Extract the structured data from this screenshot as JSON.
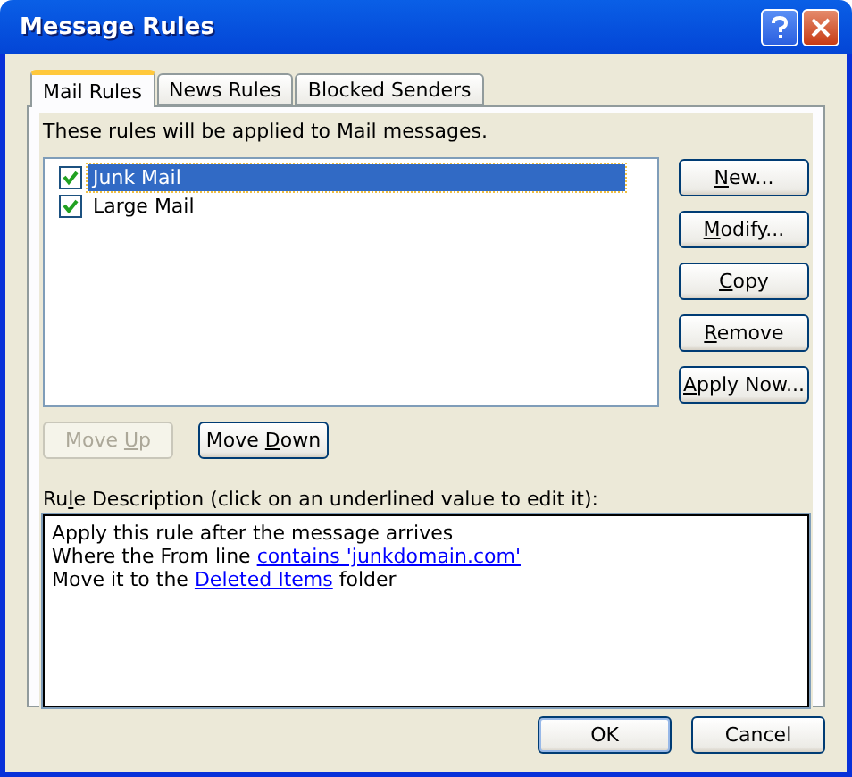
{
  "window": {
    "title": "Message Rules"
  },
  "tabs": [
    {
      "label": "Mail Rules",
      "selected": true
    },
    {
      "label": "News Rules",
      "selected": false
    },
    {
      "label": "Blocked Senders",
      "selected": false
    }
  ],
  "intro": "These rules will be applied to Mail messages.",
  "rules": [
    {
      "name": "Junk Mail",
      "checked": true,
      "selected": true
    },
    {
      "name": "Large Mail",
      "checked": true,
      "selected": false
    }
  ],
  "side_buttons": [
    {
      "key": "N",
      "post": "ew...",
      "disabled": false
    },
    {
      "key": "M",
      "post": "odify...",
      "disabled": false
    },
    {
      "key": "C",
      "post": "opy",
      "disabled": false
    },
    {
      "key": "R",
      "post": "emove",
      "disabled": false
    },
    {
      "key": "A",
      "post": "pply Now...",
      "disabled": false
    }
  ],
  "move_buttons": [
    {
      "pre": "Move ",
      "key": "U",
      "post": "p",
      "disabled": true
    },
    {
      "pre": "Move ",
      "key": "D",
      "post": "own",
      "disabled": false
    }
  ],
  "description_label": {
    "pre": "Ru",
    "key": "l",
    "post": "e Description (click on an underlined value to edit it):"
  },
  "description_lines": [
    [
      {
        "kind": "text",
        "text": "Apply this rule after the message arrives"
      }
    ],
    [
      {
        "kind": "text",
        "text": "Where the From line "
      },
      {
        "kind": "link",
        "text": "contains 'junkdomain.com'"
      }
    ],
    [
      {
        "kind": "text",
        "text": "Move it to the "
      },
      {
        "kind": "link",
        "text": "Deleted Items"
      },
      {
        "kind": "text",
        "text": " folder"
      }
    ]
  ],
  "dialog_buttons": [
    {
      "label": "OK",
      "default": true
    },
    {
      "label": "Cancel",
      "default": false
    }
  ]
}
